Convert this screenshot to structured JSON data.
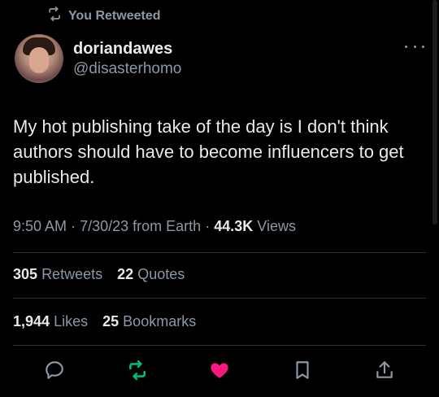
{
  "retweet_banner": {
    "text": "You Retweeted"
  },
  "author": {
    "display_name": "doriandawes",
    "handle": "@disasterhomo"
  },
  "tweet": {
    "text": "My hot publishing take of the day is I don't think authors should have to become influencers to get published."
  },
  "meta": {
    "time": "9:50 AM",
    "sep1": "·",
    "date_source": "7/30/23 from Earth",
    "sep2": "·",
    "views_count": "44.3K",
    "views_label": "Views"
  },
  "stats": {
    "retweets_count": "305",
    "retweets_label": "Retweets",
    "quotes_count": "22",
    "quotes_label": "Quotes",
    "likes_count": "1,944",
    "likes_label": "Likes",
    "bookmarks_count": "25",
    "bookmarks_label": "Bookmarks"
  },
  "colors": {
    "retweet_active": "#00ba7c",
    "like_active": "#f91880",
    "muted": "#8b98a5"
  },
  "icons": {
    "reply": "reply-icon",
    "retweet": "retweet-icon",
    "like": "heart-icon",
    "bookmark": "bookmark-icon",
    "share": "share-icon"
  }
}
